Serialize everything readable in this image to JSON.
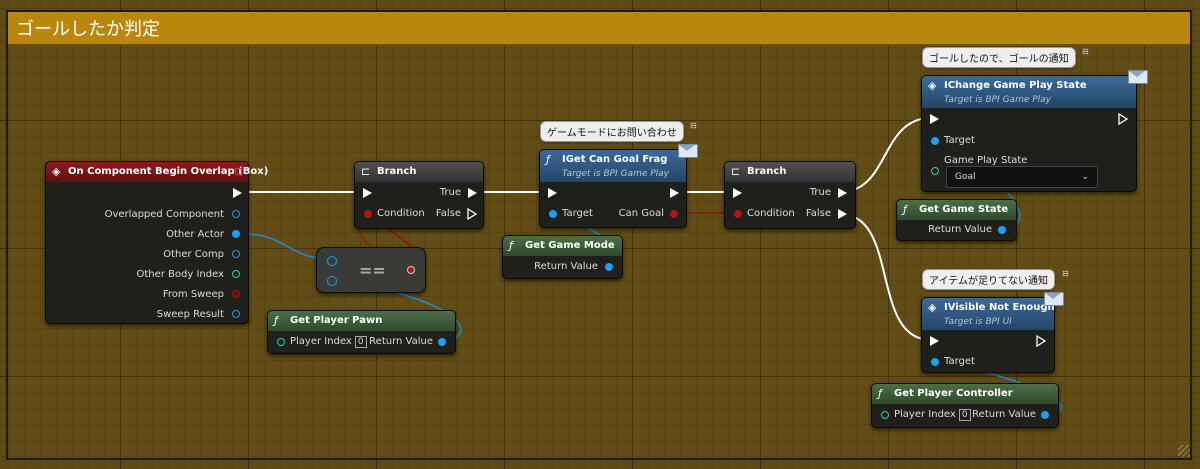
{
  "comment": {
    "title": "ゴールしたか判定"
  },
  "nodes": {
    "overlap": {
      "title": "On Component Begin Overlap (Box)",
      "pins": [
        "Overlapped Component",
        "Other Actor",
        "Other Comp",
        "Other Body Index",
        "From Sweep",
        "Sweep Result"
      ]
    },
    "branch1": {
      "title": "Branch",
      "condition": "Condition",
      "true": "True",
      "false": "False"
    },
    "equal": {
      "label": "=="
    },
    "player_pawn": {
      "title": "Get Player Pawn",
      "player_index": "Player Index",
      "index_value": "0",
      "return": "Return Value"
    },
    "goal_frag": {
      "title": "IGet Can Goal Frag",
      "subtitle": "Target is BPI Game Play",
      "target": "Target",
      "output": "Can Goal",
      "bubble": "ゲームモードにお問い合わせ"
    },
    "game_mode": {
      "title": "Get Game Mode",
      "return": "Return Value"
    },
    "branch2": {
      "title": "Branch",
      "condition": "Condition",
      "true": "True",
      "false": "False"
    },
    "change_state": {
      "title": "IChange Game Play State",
      "subtitle": "Target is BPI Game Play",
      "target": "Target",
      "param": "Game Play State",
      "value": "Goal",
      "bubble": "ゴールしたので、ゴールの通知"
    },
    "game_state": {
      "title": "Get Game State",
      "return": "Return Value"
    },
    "visible": {
      "title": "IVisible Not Enough",
      "subtitle": "Target is BPI UI",
      "target": "Target",
      "bubble": "アイテムが足りてない通知"
    },
    "player_controller": {
      "title": "Get Player Controller",
      "player_index": "Player Index",
      "index_value": "0",
      "return": "Return Value"
    }
  },
  "icons": {
    "event": "diamond-icon",
    "branch": "branch-icon",
    "function": "function-f-icon",
    "message": "envelope-icon",
    "dropdown": "chevron-down-icon"
  },
  "colors": {
    "comment_header": "#b9870e",
    "exec": "#ffffff",
    "object_pin": "#1ea0f0",
    "bool_pin": "#b41515",
    "int_pin": "#2bd3a8",
    "pure_header": "#4d6e48",
    "interface_header": "#3b6a9a",
    "event_header": "#8a1d1d"
  }
}
